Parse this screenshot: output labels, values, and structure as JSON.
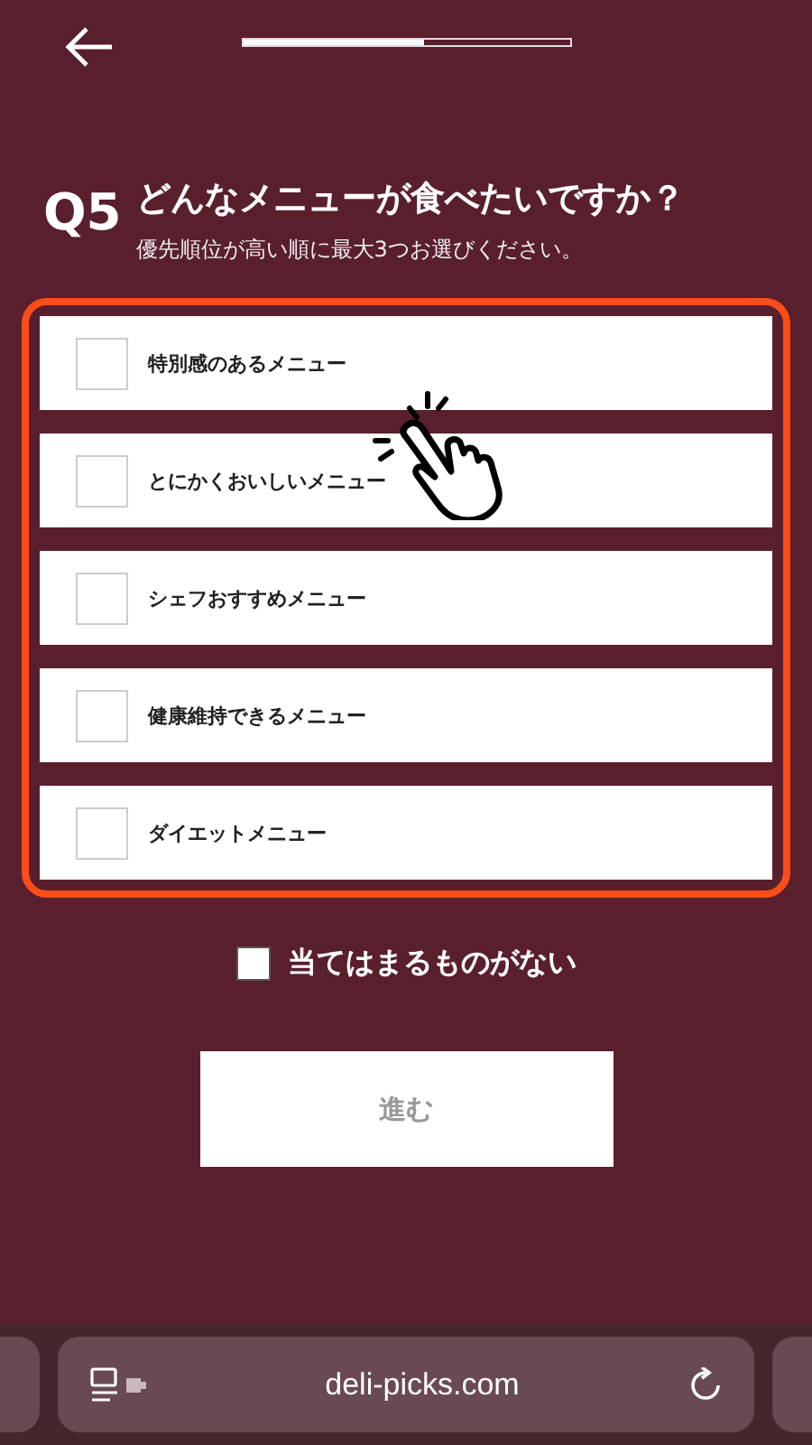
{
  "progress": {
    "level": 0.55
  },
  "question": {
    "number": "Q5",
    "title": "どんなメニューが食べたいですか？",
    "note": "優先順位が高い順に最大3つお選びください。"
  },
  "options": [
    {
      "label": "特別感のあるメニュー",
      "checked": false
    },
    {
      "label": "とにかくおいしいメニュー",
      "checked": false
    },
    {
      "label": "シェフおすすめメニュー",
      "checked": false
    },
    {
      "label": "健康維持できるメニュー",
      "checked": false
    },
    {
      "label": "ダイエットメニュー",
      "checked": false
    }
  ],
  "none_option": {
    "label": "当てはまるものがない",
    "checked": false
  },
  "next_button": {
    "label": "進む",
    "disabled": true
  },
  "browser": {
    "url": "deli-picks.com"
  }
}
